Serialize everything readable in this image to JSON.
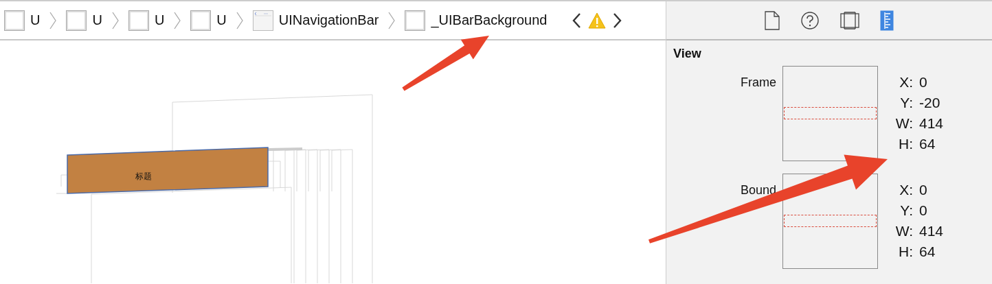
{
  "breadcrumbs": [
    {
      "kind": "view",
      "label": "U"
    },
    {
      "kind": "view",
      "label": "U"
    },
    {
      "kind": "view",
      "label": "U"
    },
    {
      "kind": "view",
      "label": "U"
    },
    {
      "kind": "navbar",
      "label": "UINavigationBar"
    },
    {
      "kind": "view",
      "label": "_UIBarBackground"
    }
  ],
  "inspector_tabs": [
    {
      "kind": "file",
      "selected": false
    },
    {
      "kind": "help",
      "selected": false
    },
    {
      "kind": "identity",
      "selected": false
    },
    {
      "kind": "size",
      "selected": true
    }
  ],
  "section_title": "View",
  "rects": [
    {
      "label": "Frame",
      "fields": [
        {
          "label": "X:",
          "value": "0"
        },
        {
          "label": "Y:",
          "value": "-20"
        },
        {
          "label": "W:",
          "value": "414"
        },
        {
          "label": "H:",
          "value": "64"
        }
      ]
    },
    {
      "label": "Bound",
      "fields": [
        {
          "label": "X:",
          "value": "0"
        },
        {
          "label": "Y:",
          "value": "0"
        },
        {
          "label": "W:",
          "value": "414"
        },
        {
          "label": "H:",
          "value": "64"
        }
      ]
    }
  ],
  "canvas": {
    "bar_title": "标题"
  }
}
